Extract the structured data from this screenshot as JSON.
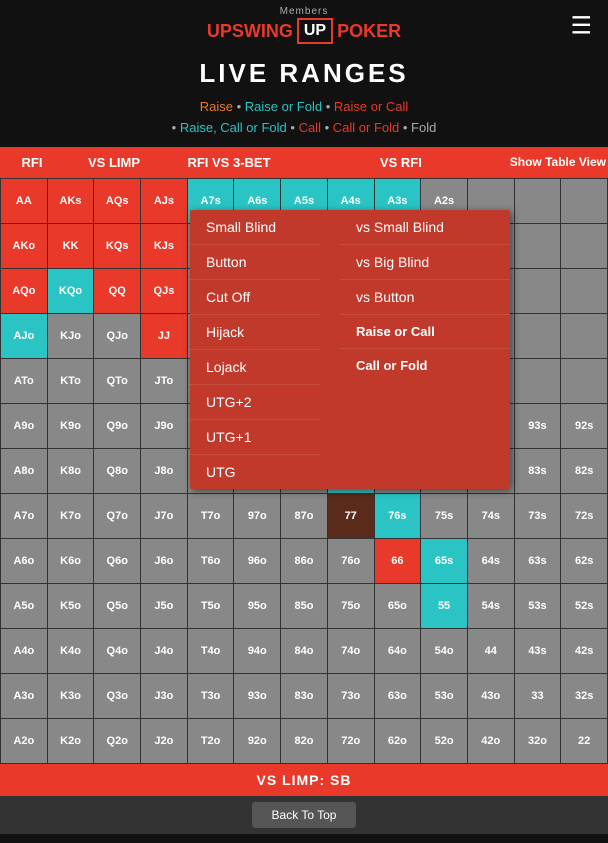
{
  "header": {
    "members_label": "Members",
    "logo_left": "UPSWING",
    "logo_mid": "UP",
    "logo_right": "POKER",
    "menu_icon": "☰"
  },
  "page": {
    "title": "LIVE RANGES"
  },
  "legend": {
    "items": [
      {
        "label": "Raise",
        "color": "#e87a2a"
      },
      {
        "label": "Raise or Fold",
        "color": "#2ac4c4"
      },
      {
        "label": "Raise or Call",
        "color": "#e8392a"
      },
      {
        "label": "Raise, Call or Fold",
        "color": "#e8392a"
      },
      {
        "label": "Call",
        "color": "#e8392a"
      },
      {
        "label": "Call or Fold",
        "color": "#e8392a"
      },
      {
        "label": "Fold",
        "color": "#e8392a"
      }
    ]
  },
  "table_headers": {
    "rfi": "RFI",
    "vs_limp": "VS LIMP",
    "rfi_vs_3bet": "RFI VS 3-BET",
    "vs_rfi": "VS RFI",
    "show_table_view": "Show Table View"
  },
  "dropdown": {
    "position_items": [
      "Small Blind",
      "Button",
      "Cut Off",
      "Hijack",
      "Lojack",
      "UTG+2",
      "UTG+1",
      "UTG"
    ],
    "vs_items": [
      "vs Small Blind",
      "vs Big Blind",
      "vs Button"
    ],
    "special_items": [
      "Raise or Call",
      "Call or Fold"
    ]
  },
  "bottom_bar": {
    "label": "VS LIMP: SB"
  },
  "back_to_top": {
    "label": "Back To Top"
  }
}
